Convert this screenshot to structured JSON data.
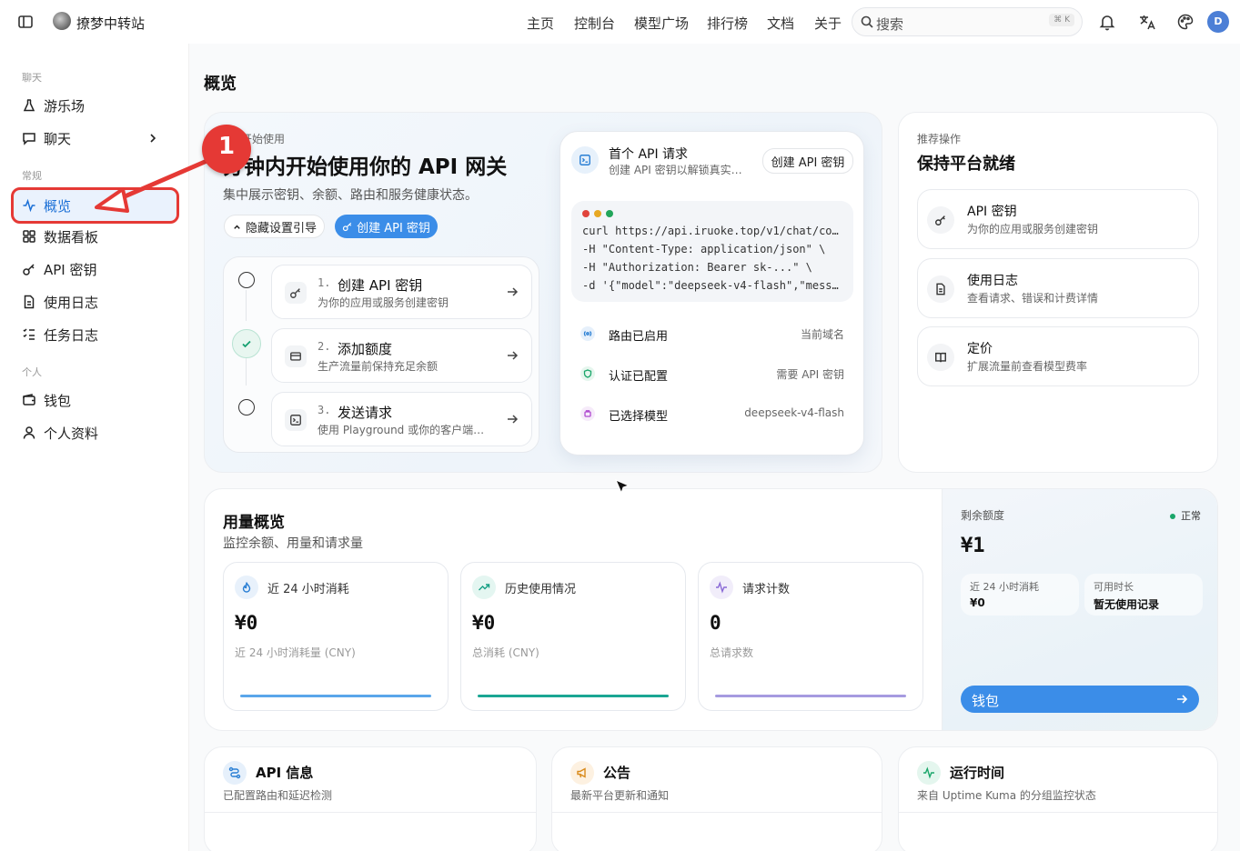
{
  "header": {
    "brand": "撩梦中转站",
    "nav": [
      "主页",
      "控制台",
      "模型广场",
      "排行榜",
      "文档",
      "关于"
    ],
    "search_placeholder": "搜索",
    "search_shortcut": "⌘ K",
    "avatar": "D"
  },
  "sidebar": {
    "sections": [
      "聊天",
      "常规",
      "个人"
    ],
    "items": [
      {
        "label": "游乐场",
        "icon": "flask-icon"
      },
      {
        "label": "聊天",
        "icon": "chat-icon"
      },
      {
        "label": "概览",
        "icon": "activity-icon",
        "active": true
      },
      {
        "label": "数据看板",
        "icon": "grid-icon"
      },
      {
        "label": "API 密钥",
        "icon": "key-icon"
      },
      {
        "label": "使用日志",
        "icon": "document-icon"
      },
      {
        "label": "任务日志",
        "icon": "checklist-icon"
      },
      {
        "label": "钱包",
        "icon": "wallet-icon"
      },
      {
        "label": "个人资料",
        "icon": "user-icon"
      }
    ]
  },
  "page": {
    "title": "概览"
  },
  "getting_started": {
    "eyebrow": "开始使用",
    "title": "分钟内开始使用你的 API 网关",
    "subtitle": "集中展示密钥、余额、路由和服务健康状态。",
    "hide_btn": "隐藏设置引导",
    "create_btn": "创建 API 密钥",
    "steps": [
      {
        "num": "1.",
        "title": "创建 API 密钥",
        "desc": "为你的应用或服务创建密钥",
        "done": false
      },
      {
        "num": "2.",
        "title": "添加额度",
        "desc": "生产流量前保持充足余额",
        "done": true
      },
      {
        "num": "3.",
        "title": "发送请求",
        "desc": "使用 Playground 或你的客户端验证",
        "done": false
      }
    ]
  },
  "first_request": {
    "title": "首个 API 请求",
    "desc": "创建 API 密钥以解锁真实…",
    "button": "创建 API 密钥",
    "code": [
      "curl https://api.iruoke.top/v1/chat/co…",
      "-H \"Content-Type: application/json\" \\",
      "-H \"Authorization: Bearer sk-...\" \\",
      "-d '{\"model\":\"deepseek-v4-flash\",\"mess…"
    ],
    "status": [
      {
        "label": "路由已启用",
        "value": "当前域名"
      },
      {
        "label": "认证已配置",
        "value": "需要 API 密钥"
      },
      {
        "label": "已选择模型",
        "value": "deepseek-v4-flash"
      }
    ]
  },
  "recommended": {
    "eyebrow": "推荐操作",
    "title": "保持平台就绪",
    "items": [
      {
        "title": "API 密钥",
        "desc": "为你的应用或服务创建密钥"
      },
      {
        "title": "使用日志",
        "desc": "查看请求、错误和计费详情"
      },
      {
        "title": "定价",
        "desc": "扩展流量前查看模型费率"
      }
    ]
  },
  "usage": {
    "title": "用量概览",
    "subtitle": "监控余额、用量和请求量",
    "metrics": [
      {
        "label": "近 24 小时消耗",
        "value": "¥0",
        "foot": "近 24 小时消耗量 (CNY)"
      },
      {
        "label": "历史使用情况",
        "value": "¥0",
        "foot": "总消耗 (CNY)"
      },
      {
        "label": "请求计数",
        "value": "0",
        "foot": "总请求数"
      }
    ]
  },
  "balance": {
    "label": "剩余额度",
    "status": "正常",
    "value": "¥1",
    "sub1_label": "近 24 小时消耗",
    "sub1_value": "¥0",
    "sub2_label": "可用时长",
    "sub2_value": "暂无使用记录",
    "wallet_btn": "钱包"
  },
  "bottom": [
    {
      "title": "API 信息",
      "desc": "已配置路由和延迟检测"
    },
    {
      "title": "公告",
      "desc": "最新平台更新和通知"
    },
    {
      "title": "运行时间",
      "desc": "来自 Uptime Kuma 的分组监控状态"
    }
  ],
  "annotation": {
    "number": "1"
  },
  "colors": {
    "accent": "#3b8de8",
    "annotation": "#e53935",
    "success": "#16a070"
  }
}
